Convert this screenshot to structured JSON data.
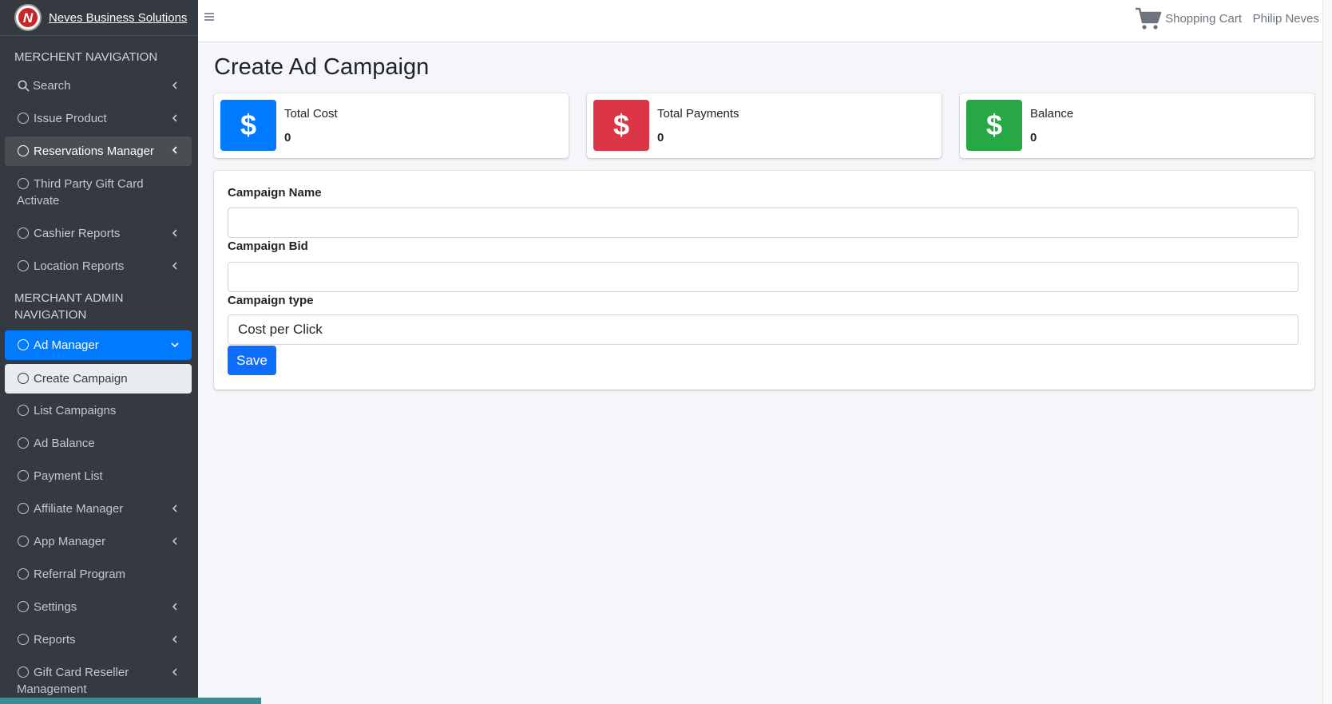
{
  "brand": {
    "name": "Neves Business Solutions"
  },
  "sidebar": {
    "header_merchant": "MERCHENT NAVIGATION",
    "header_admin_line1": "MERCHANT ADMIN",
    "header_admin_line2": "NAVIGATION",
    "items": [
      {
        "label": "Search",
        "icon": "search-icon"
      },
      {
        "label": "Issue Product",
        "icon": "circle-icon"
      },
      {
        "label": "Reservations Manager",
        "icon": "circle-icon"
      },
      {
        "label_line1": "Third Party Gift Card",
        "label_line2": "Activate",
        "icon": "circle-icon"
      },
      {
        "label": "Cashier Reports",
        "icon": "circle-icon"
      },
      {
        "label": "Location Reports",
        "icon": "circle-icon"
      },
      {
        "label": "Ad Manager",
        "icon": "circle-icon"
      },
      {
        "label": "Create Campaign",
        "icon": "circle-icon"
      },
      {
        "label": "List Campaigns",
        "icon": "circle-icon"
      },
      {
        "label": "Ad Balance",
        "icon": "circle-icon"
      },
      {
        "label": "Payment List",
        "icon": "circle-icon"
      },
      {
        "label": "Affiliate Manager",
        "icon": "circle-icon"
      },
      {
        "label": "App Manager",
        "icon": "circle-icon"
      },
      {
        "label": "Referral Program",
        "icon": "circle-icon"
      },
      {
        "label": "Settings",
        "icon": "circle-icon"
      },
      {
        "label": "Reports",
        "icon": "circle-icon"
      },
      {
        "label_line1": "Gift Card Reseller",
        "label_line2": "Management",
        "icon": "circle-icon"
      }
    ]
  },
  "navbar": {
    "cart_label": "Shopping Cart",
    "user_name": "Philip Neves"
  },
  "page": {
    "title": "Create Ad Campaign"
  },
  "info_boxes": [
    {
      "label": "Total Cost",
      "value": "0",
      "symbol": "$",
      "color": "#007bff"
    },
    {
      "label": "Total Payments",
      "value": "0",
      "symbol": "$",
      "color": "#dc3545"
    },
    {
      "label": "Balance",
      "value": "0",
      "symbol": "$",
      "color": "#28a745"
    }
  ],
  "form": {
    "campaign_name_label": "Campaign Name",
    "campaign_name_value": "",
    "campaign_bid_label": "Campaign Bid",
    "campaign_bid_value": "",
    "campaign_type_label": "Campaign type",
    "campaign_type_selected": "Cost per Click",
    "save_label": "Save"
  },
  "colors": {
    "sidebar_bg": "#343a40",
    "accent": "#007bff",
    "danger": "#dc3545",
    "success": "#28a745"
  }
}
